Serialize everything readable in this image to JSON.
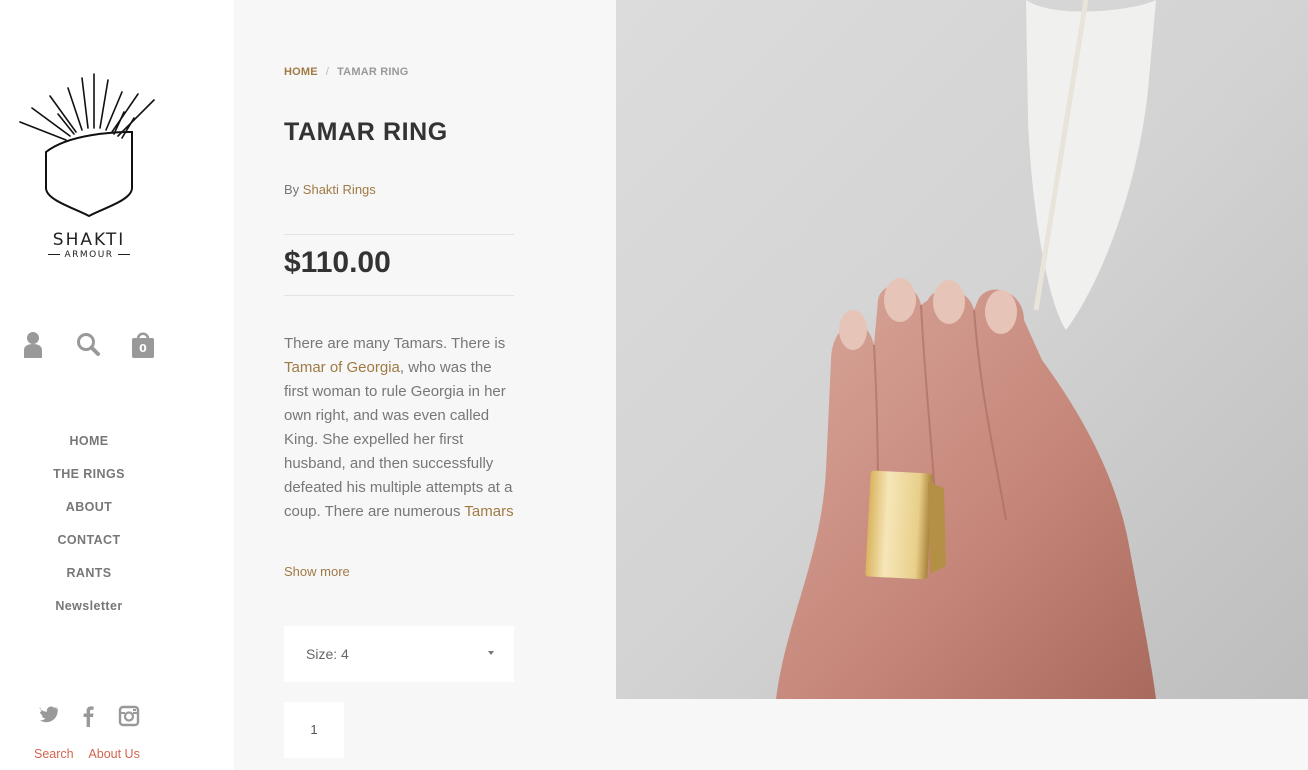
{
  "brand": {
    "name": "SHAKTI",
    "sub": "ARMOUR"
  },
  "utility": {
    "account_icon": "account-icon",
    "search_icon": "search-icon",
    "cart_icon": "cart-icon",
    "cart_count": "0"
  },
  "nav": {
    "items": [
      {
        "label": "HOME"
      },
      {
        "label": "THE RINGS"
      },
      {
        "label": "ABOUT"
      },
      {
        "label": "CONTACT"
      },
      {
        "label": "RANTS"
      },
      {
        "label": "Newsletter"
      }
    ]
  },
  "social": {
    "icons": [
      "twitter-icon",
      "facebook-icon",
      "instagram-icon"
    ]
  },
  "footer": {
    "links": [
      "Search",
      "About Us"
    ]
  },
  "breadcrumb": {
    "home": "HOME",
    "separator": "/",
    "current": "TAMAR RING"
  },
  "product": {
    "title": "TAMAR RING",
    "vendor_prefix": "By ",
    "vendor": "Shakti Rings",
    "price": "$110.00",
    "description": {
      "part1": "There are many Tamars. There is ",
      "link1": "Tamar of Georgia",
      "part2": ", who was the first woman to rule Georgia in her own right, and was even called King. She expelled her first husband, and then successfully defeated his multiple attempts at a coup. There are numerous ",
      "link2": "Tamars"
    },
    "show_more": "Show more",
    "size_label": "Size: 4",
    "quantity": "1"
  },
  "colors": {
    "accent": "#a07a45",
    "footer_link": "#d4634f",
    "background": "#f7f7f7"
  }
}
